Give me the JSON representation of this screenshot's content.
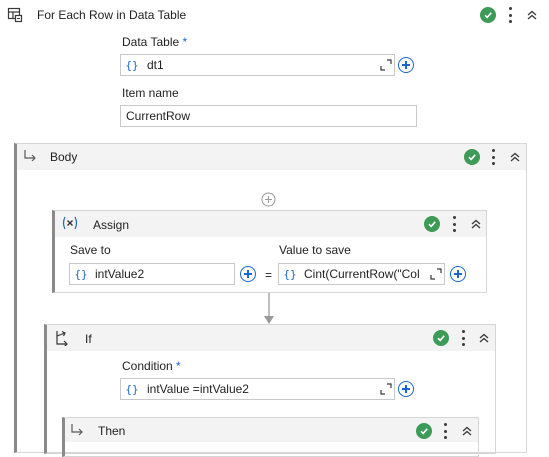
{
  "foreach": {
    "title": "For Each Row in Data Table",
    "data_table_label": "Data Table",
    "required_mark": "*",
    "data_table_value": "dt1",
    "item_name_label": "Item name",
    "item_name_value": "CurrentRow"
  },
  "body": {
    "title": "Body"
  },
  "assign": {
    "title": "Assign",
    "save_to_label": "Save to",
    "save_to_value": "intValue2",
    "value_label": "Value to save",
    "value_value": "Cint(CurrentRow(\"Col",
    "equals": "="
  },
  "if_block": {
    "title": "If",
    "condition_label": "Condition",
    "required_mark": "*",
    "condition_value": "intValue =intValue2"
  },
  "then": {
    "title": "Then"
  },
  "glyphs": {
    "brace": "{}"
  },
  "colors": {
    "accent": "#1a66cc",
    "success": "#3d9a57",
    "header_bg": "#f3f3f3",
    "border": "#c9c9c9"
  },
  "icons": [
    "for-each-row-icon",
    "body-sequence-icon",
    "assign-icon",
    "if-icon",
    "then-sequence-icon",
    "validation-check-icon",
    "more-options-icon",
    "collapse-icon",
    "expand-editor-icon",
    "add-icon",
    "brace-variable-icon"
  ]
}
